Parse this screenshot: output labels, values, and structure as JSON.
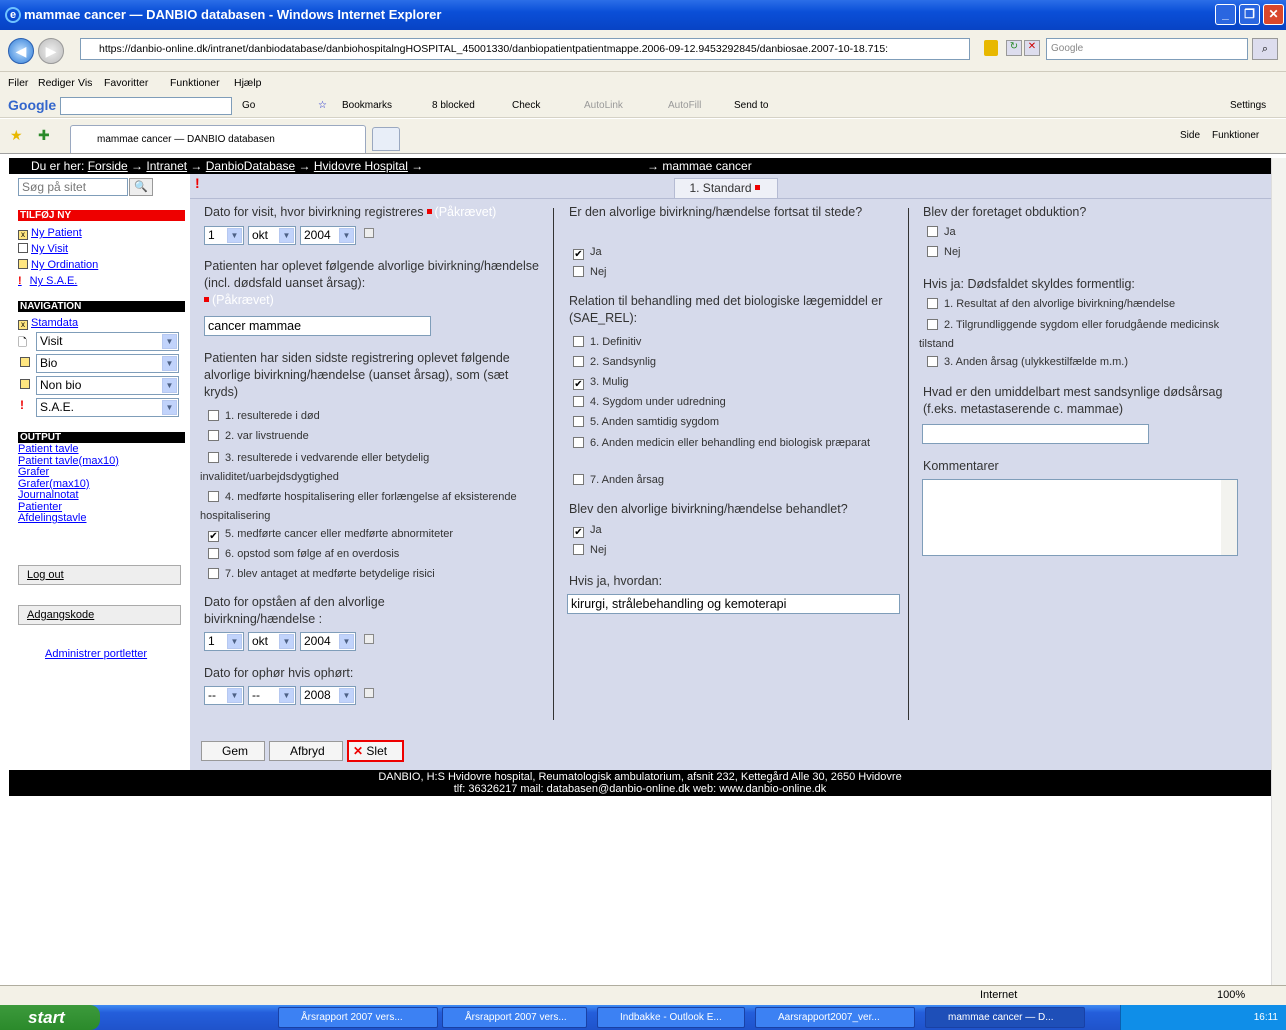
{
  "window": {
    "title": "mammae cancer — DANBIO databasen - Windows Internet Explorer"
  },
  "browser": {
    "address": "https://danbio-online.dk/intranet/danbiodatabase/danbiohospitalngHOSPITAL_45001330/danbiopatientpatientmappe.2006-09-12.9453292845/danbiosae.2007-10-18.715:",
    "search_placeholder": "Google",
    "menu": [
      "Filer",
      "Rediger",
      "Vis",
      "Favoritter",
      "Funktioner",
      "Hjælp"
    ],
    "google_toolbar": {
      "go": "Go",
      "bookmarks": "Bookmarks",
      "blocked": "8 blocked",
      "check": "Check",
      "autolink": "AutoLink",
      "autofill": "AutoFill",
      "sendto": "Send to",
      "settings": "Settings"
    },
    "tab_title": "mammae cancer — DANBIO databasen",
    "cmd": {
      "side": "Side",
      "funktioner": "Funktioner"
    }
  },
  "breadcrumb": {
    "prefix": "Du er her:",
    "items": [
      "Forside",
      "Intranet",
      "DanbioDatabase",
      "Hvidovre Hospital"
    ],
    "current": "mammae cancer"
  },
  "sidebar": {
    "search_placeholder": "Søg på sitet",
    "add_head": "TILFØJ NY",
    "add_items": [
      "Ny Patient",
      "Ny Visit",
      "Ny Ordination",
      "Ny S.A.E."
    ],
    "nav_head": "NAVIGATION",
    "stamdata": "Stamdata",
    "selects": [
      "Visit",
      "Bio",
      "Non bio",
      "S.A.E."
    ],
    "output_head": "OUTPUT",
    "output_items": [
      "Patient tavle",
      "Patient tavle(max10)",
      "Grafer",
      "Grafer(max10)",
      "Journalnotat",
      "Patienter",
      "Afdelingstavle"
    ],
    "logout": "Log out",
    "password": "Adgangskode",
    "admin": "Administrer portletter"
  },
  "form": {
    "tab": "1. Standard",
    "required": "(Påkrævet)",
    "visit_date_label": "Dato for visit, hvor bivirkning registreres",
    "visit_date": {
      "day": "1",
      "month": "okt",
      "year": "2004"
    },
    "experienced_label": "Patienten har oplevet følgende alvorlige bivirkning/hændelse (incl. dødsfald uanset årsag):",
    "experienced_value": "cancer mammae",
    "since_label": "Patienten har siden sidste registrering oplevet følgende alvorlige bivirkning/hændelse (uanset årsag), som (sæt kryds)",
    "since_options": [
      "1. resulterede i død",
      "2. var livstruende",
      "3. resulterede i vedvarende eller betydelig invaliditet/uarbejdsdygtighed",
      "4. medførte hospitalisering eller forlængelse af eksisterende hospitalisering",
      "5. medførte cancer eller medførte abnormiteter",
      "6. opstod som følge af en overdosis",
      "7. blev antaget at medførte betydelige risici"
    ],
    "onset_label": "Dato for opståen af den alvorlige bivirkning/hændelse :",
    "onset_date": {
      "day": "1",
      "month": "okt",
      "year": "2004"
    },
    "end_label": "Dato for ophør hvis ophørt:",
    "end_date": {
      "day": "--",
      "month": "--",
      "year": "2008"
    },
    "still_label": "Er den alvorlige bivirkning/hændelse fortsat til stede?",
    "yes": "Ja",
    "no": "Nej",
    "relation_label": "Relation til behandling med det biologiske lægemiddel er (SAE_REL):",
    "relation_options": [
      "1. Definitiv",
      "2. Sandsynlig",
      "3. Mulig",
      "4. Sygdom under udredning",
      "5. Anden samtidig sygdom",
      "6. Anden medicin eller behandling end biologisk præparat",
      "7. Anden årsag"
    ],
    "treated_label": "Blev den alvorlige bivirkning/hændelse behandlet?",
    "how_label": "Hvis ja, hvordan:",
    "how_value": "kirurgi, strålebehandling og kemoterapi",
    "autopsy_label": "Blev der foretaget obduktion?",
    "death_label": "Hvis ja: Dødsfaldet skyldes formentlig:",
    "death_options": [
      "1. Resultat af den alvorlige bivirkning/hændelse",
      "2. Tilgrundliggende sygdom eller forudgående medicinsk tilstand",
      "3. Anden årsag (ulykkestilfælde m.m.)"
    ],
    "cause_label": "Hvad er den umiddelbart mest sandsynlige dødsårsag (f.eks. metastaserende c. mammae)",
    "comments_label": "Kommentarer",
    "save": "Gem",
    "cancel": "Afbryd",
    "delete": "Slet"
  },
  "footer": {
    "line1": "DANBIO, H:S Hvidovre hospital, Reumatologisk ambulatorium, afsnit 232, Kettegård Alle 30, 2650 Hvidovre",
    "line2": "tlf: 36326217 mail: databasen@danbio-online.dk web: www.danbio-online.dk"
  },
  "status": {
    "zone": "Internet",
    "zoom": "100%"
  },
  "taskbar": {
    "start": "start",
    "items": [
      "Årsrapport 2007 vers...",
      "Årsrapport 2007 vers...",
      "Indbakke - Outlook E...",
      "Aarsrapport2007_ver...",
      "mammae cancer — D..."
    ],
    "clock": "16:11"
  }
}
